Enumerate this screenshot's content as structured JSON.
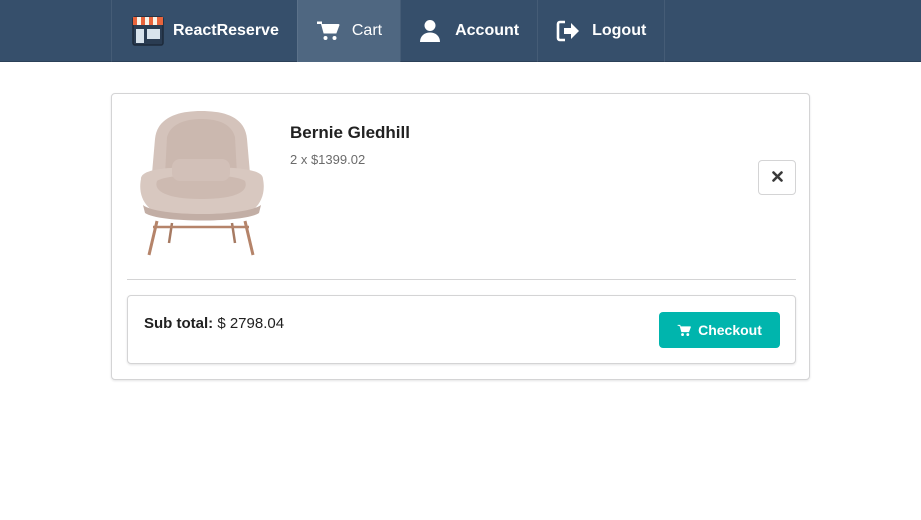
{
  "nav": {
    "brand": "ReactReserve",
    "items": [
      {
        "label": "Cart",
        "icon": "cart-icon",
        "active": true
      },
      {
        "label": "Account",
        "icon": "user-icon",
        "active": false
      },
      {
        "label": "Logout",
        "icon": "sign-out-icon",
        "active": false
      }
    ]
  },
  "cart": {
    "items": [
      {
        "name": "Bernie Gledhill",
        "meta": "2 x $1399.02",
        "remove_icon": "close-icon"
      }
    ],
    "subtotal_label": "Sub total:",
    "subtotal_value": " $ 2798.04",
    "checkout_label": "Checkout"
  },
  "colors": {
    "navbar": "#364f6b",
    "nav_active": "#4f6781",
    "checkout": "#00b5ad"
  }
}
